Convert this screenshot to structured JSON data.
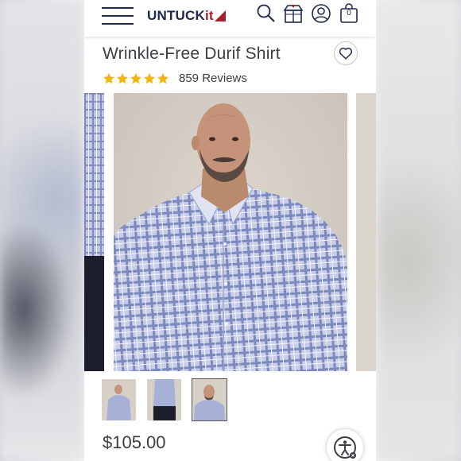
{
  "header": {
    "logo_main": "UNTUCK",
    "logo_accent": "it",
    "cart_count": "0",
    "icons": [
      "menu-icon",
      "search-icon",
      "store-icon",
      "account-icon",
      "cart-icon"
    ]
  },
  "product": {
    "title": "Wrinkle-Free Durif Shirt",
    "rating": 5,
    "rating_max": 5,
    "reviews_label": "859 Reviews",
    "price": "$105.00"
  },
  "gallery": {
    "thumbnail_count": 3,
    "active_index": 2
  },
  "colors": {
    "brand_navy": "#1d2a4e",
    "brand_red": "#a5202f",
    "star_gold": "#f2b705",
    "text": "#3b3d42"
  }
}
